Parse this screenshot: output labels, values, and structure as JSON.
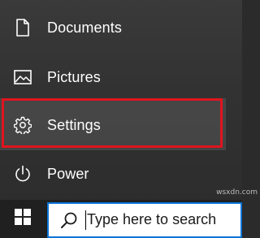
{
  "start_menu": {
    "items": [
      {
        "label": "Documents",
        "icon": "document-icon"
      },
      {
        "label": "Pictures",
        "icon": "picture-icon"
      },
      {
        "label": "Settings",
        "icon": "gear-icon"
      },
      {
        "label": "Power",
        "icon": "power-icon"
      }
    ]
  },
  "taskbar": {
    "start_icon": "windows-logo-icon",
    "search": {
      "placeholder": "Type here to search",
      "icon": "search-icon"
    }
  },
  "watermark": "wsxdn.com",
  "colors": {
    "highlight": "#e0141e",
    "search_border": "#0a74d6",
    "menu_bg": "#333333",
    "taskbar_bg": "#202020"
  }
}
